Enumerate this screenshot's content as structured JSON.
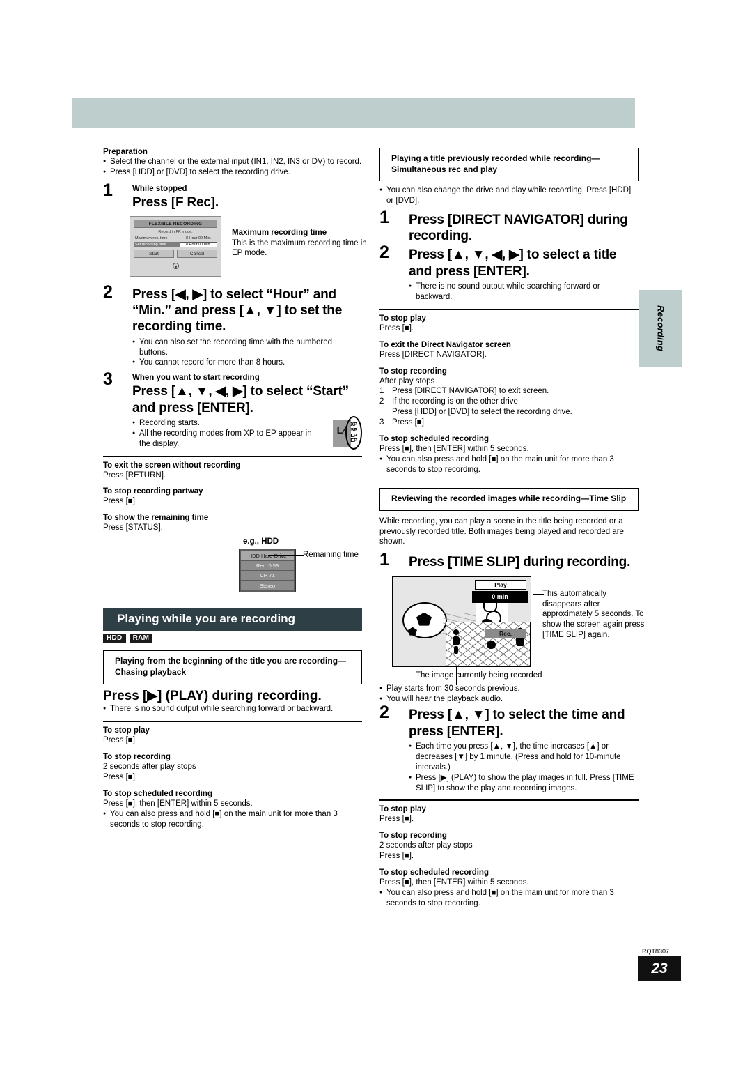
{
  "page": {
    "number": "23",
    "doc_code": "RQT8307",
    "side_tab": "Recording"
  },
  "left": {
    "preparation": {
      "heading": "Preparation",
      "bullets": [
        "Select the channel or the external input (IN1, IN2, IN3 or DV) to record.",
        "Press [HDD] or [DVD] to select the recording drive."
      ]
    },
    "step1": {
      "num": "1",
      "sub": "While stopped",
      "title": "Press [F Rec]."
    },
    "fr_dialog": {
      "title": "FLEXIBLE RECORDING",
      "subtitle": "Record in FR mode.",
      "max_label": "Maximum rec. time",
      "max_value": "8 Hour 00 Min.",
      "set_label": "Set recording time",
      "set_value": "8 Hour 00 Min.",
      "start_button": "Start",
      "cancel_button": "Cancel"
    },
    "fr_callout": {
      "title": "Maximum recording time",
      "body": "This is the maximum recording time in EP mode."
    },
    "step2": {
      "num": "2",
      "title": "Press [◀, ▶] to select “Hour” and “Min.” and press [▲, ▼] to set the recording time.",
      "bullets": [
        "You can also set the recording time with the numbered buttons.",
        "You cannot record for more than 8 hours."
      ]
    },
    "step3": {
      "num": "3",
      "sub": "When you want to start recording",
      "title": "Press [▲, ▼, ◀, ▶] to select “Start” and press [ENTER].",
      "bullets": [
        "Recording starts.",
        "All the recording modes from XP to EP appear in the display."
      ]
    },
    "display_modes": [
      "XP",
      "SP",
      "LP",
      "EP"
    ],
    "notes1": [
      {
        "head": "To exit the screen without recording",
        "lines": [
          "Press [RETURN]."
        ]
      },
      {
        "head": "To stop recording partway",
        "lines": [
          "Press [■]."
        ]
      },
      {
        "head": "To show the remaining time",
        "lines": [
          "Press [STATUS]."
        ]
      }
    ],
    "hdd_example": {
      "caption": "e.g., HDD",
      "rows": [
        "HDD Hard-Drive",
        "Rec. 0:59",
        "CH 71",
        "Stereo"
      ],
      "callout": "Remaining time"
    },
    "section": {
      "title": "Playing while you are recording",
      "badges": [
        "HDD",
        "RAM"
      ]
    },
    "chasing": {
      "boxed": "Playing from the beginning of the title you are recording—Chasing playback",
      "title": "Press [▶] (PLAY) during recording.",
      "bullet": "There is no sound output while searching forward or backward."
    },
    "notes2": [
      {
        "head": "To stop play",
        "lines": [
          "Press [■]."
        ]
      },
      {
        "head": "To stop recording",
        "lines": [
          "2 seconds after play stops",
          "Press [■]."
        ]
      },
      {
        "head": "To stop scheduled recording",
        "lines": [
          "Press [■], then [ENTER] within 5 seconds."
        ],
        "bullet": "You can also press and hold [■] on the main unit for more than 3 seconds to stop recording."
      }
    ]
  },
  "right": {
    "simul": {
      "boxed": "Playing a title previously recorded while recording—Simultaneous rec and play",
      "bullet": "You can also change the drive and play while recording. Press [HDD] or [DVD].",
      "step1": {
        "num": "1",
        "title": "Press [DIRECT NAVIGATOR] during recording."
      },
      "step2": {
        "num": "2",
        "title": "Press [▲, ▼, ◀, ▶] to select a title and press [ENTER].",
        "bullet": "There is no sound output while searching forward or backward."
      }
    },
    "notes1": [
      {
        "head": "To stop play",
        "lines": [
          "Press [■]."
        ]
      },
      {
        "head": "To exit the Direct Navigator screen",
        "lines": [
          "Press [DIRECT NAVIGATOR]."
        ]
      }
    ],
    "stop_recording": {
      "head": "To stop recording",
      "intro": "After play stops",
      "items": [
        {
          "n": "1",
          "text": "Press [DIRECT NAVIGATOR] to exit screen."
        },
        {
          "n": "2",
          "text": "If the recording is on the other drive\nPress [HDD] or [DVD] to select the recording drive."
        },
        {
          "n": "3",
          "text": "Press [■]."
        }
      ]
    },
    "stop_scheduled": {
      "head": "To stop scheduled recording",
      "line": "Press [■], then [ENTER] within 5 seconds.",
      "bullet": "You can also press and hold [■] on the main unit for more than 3 seconds to stop recording."
    },
    "timeslip": {
      "boxed": "Reviewing the recorded images while recording—Time Slip",
      "intro": "While recording, you can play a scene in the title being recorded or a previously recorded title. Both images being played and recorded are shown.",
      "step1": {
        "num": "1",
        "title": "Press [TIME SLIP] during recording."
      },
      "tv": {
        "play_label": "Play",
        "play_value": "0 min",
        "rec_label": "Rec."
      },
      "tv_callout": "This automatically disappears after approximately 5 seconds. To show the screen again press [TIME SLIP] again.",
      "tv_caption": "The image currently being recorded",
      "bullets": [
        "Play starts from 30 seconds previous.",
        "You will hear the playback audio."
      ],
      "step2": {
        "num": "2",
        "title": "Press [▲, ▼] to select the time and press [ENTER].",
        "bullets": [
          "Each time you press [▲, ▼], the time increases [▲] or decreases [▼] by 1 minute. (Press and hold for 10-minute intervals.)",
          "Press [▶] (PLAY) to show the play images in full. Press [TIME SLIP] to show the play and recording images."
        ]
      }
    },
    "notes2": [
      {
        "head": "To stop play",
        "lines": [
          "Press [■]."
        ]
      },
      {
        "head": "To stop recording",
        "lines": [
          "2 seconds after play stops",
          "Press [■]."
        ]
      },
      {
        "head": "To stop scheduled recording",
        "lines": [
          "Press [■], then [ENTER] within 5 seconds."
        ],
        "bullet": "You can also press and hold [■] on the main unit for more than 3 seconds to stop recording."
      }
    ]
  }
}
